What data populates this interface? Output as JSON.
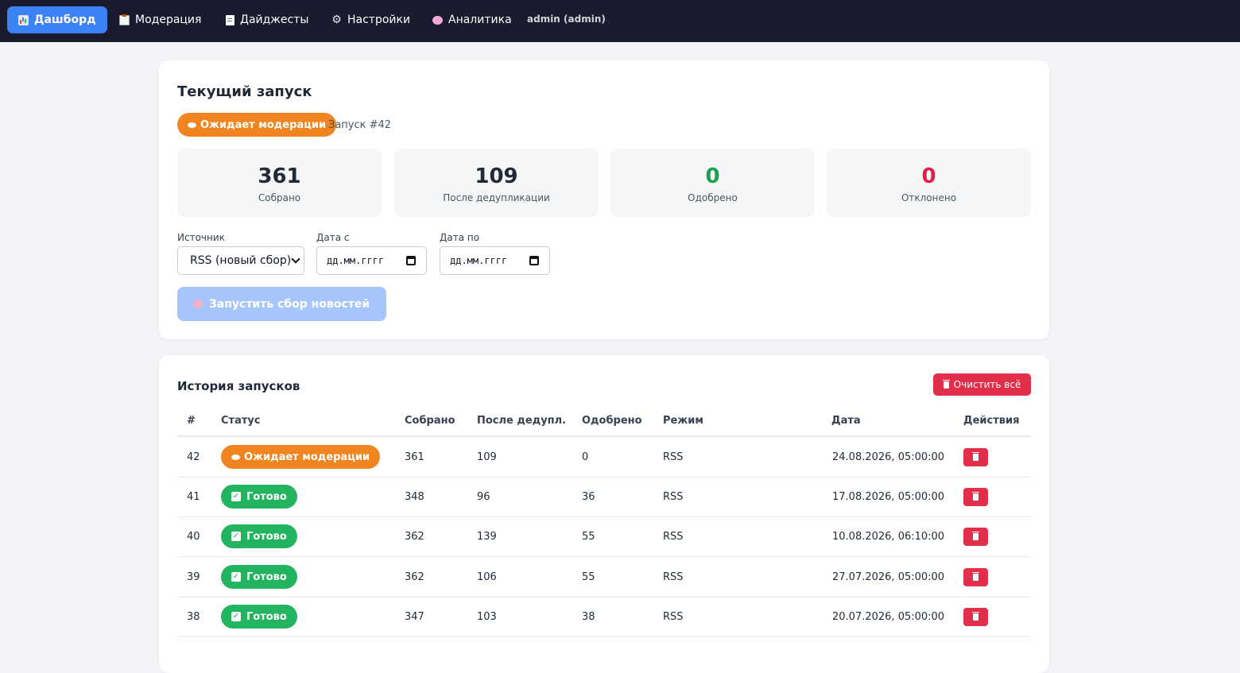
{
  "nav": {
    "items": [
      {
        "label": "Дашборд",
        "icon": "bar-chart-icon",
        "active": true
      },
      {
        "label": "Модерация",
        "icon": "clipboard-icon"
      },
      {
        "label": "Дайджесты",
        "icon": "document-icon"
      },
      {
        "label": "Настройки",
        "icon": "gear-icon"
      },
      {
        "label": "Аналитика",
        "icon": "brain-icon"
      }
    ],
    "user": "admin (admin)"
  },
  "current": {
    "title": "Текущий запуск",
    "status": "Ожидает модерации",
    "run_label": "Запуск #42",
    "stats": [
      {
        "value": "361",
        "label": "Собрано"
      },
      {
        "value": "109",
        "label": "После дедупликации"
      },
      {
        "value": "0",
        "label": "Одобрено"
      },
      {
        "value": "0",
        "label": "Отклонено"
      }
    ],
    "source_label": "Источник",
    "source_value": "RSS (новый сбор)",
    "date_from_label": "Дата с",
    "date_from_placeholder": "дд.мм.гггг",
    "date_to_label": "Дата по",
    "date_to_placeholder": "дд.мм.гггг",
    "run_button": "Запустить сбор новостей"
  },
  "history": {
    "title": "История запусков",
    "clear_button": "Очистить всё",
    "columns": [
      "#",
      "Статус",
      "Собрано",
      "После дедупл.",
      "Одобрено",
      "Режим",
      "Дата",
      "Действия"
    ],
    "rows": [
      {
        "id": "42",
        "status": "Ожидает модерации",
        "collected": "361",
        "dedup": "109",
        "approved": "0",
        "mode": "RSS",
        "date": "24.08.2026, 05:00:00"
      },
      {
        "id": "41",
        "status": "Готово",
        "collected": "348",
        "dedup": "96",
        "approved": "36",
        "mode": "RSS",
        "date": "17.08.2026, 05:00:00"
      },
      {
        "id": "40",
        "status": "Готово",
        "collected": "362",
        "dedup": "139",
        "approved": "55",
        "mode": "RSS",
        "date": "10.08.2026, 06:10:00"
      },
      {
        "id": "39",
        "status": "Готово",
        "collected": "362",
        "dedup": "106",
        "approved": "55",
        "mode": "RSS",
        "date": "27.07.2026, 05:00:00"
      },
      {
        "id": "38",
        "status": "Готово",
        "collected": "347",
        "dedup": "103",
        "approved": "38",
        "mode": "RSS",
        "date": "20.07.2026, 05:00:00"
      }
    ]
  },
  "colors": {
    "nav_bg": "#1b1b2f",
    "accent": "#3b82f6",
    "pending": "#f0851f",
    "done": "#22b45f",
    "danger": "#e02e4b"
  }
}
